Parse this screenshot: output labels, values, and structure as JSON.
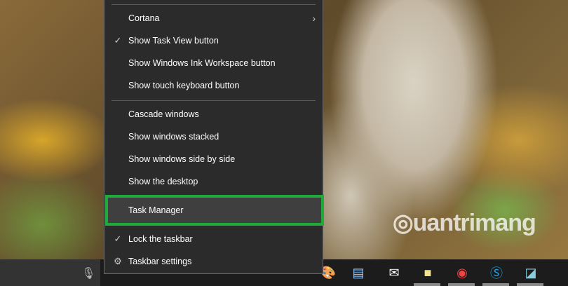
{
  "menu": {
    "items": [
      {
        "label": "Cortana",
        "icon": "",
        "submenu": true
      },
      {
        "label": "Show Task View button",
        "icon": "check-icon"
      },
      {
        "label": "Show Windows Ink Workspace button",
        "icon": ""
      },
      {
        "label": "Show touch keyboard button",
        "icon": ""
      },
      {
        "label": "Cascade windows",
        "icon": ""
      },
      {
        "label": "Show windows stacked",
        "icon": ""
      },
      {
        "label": "Show windows side by side",
        "icon": ""
      },
      {
        "label": "Show the desktop",
        "icon": ""
      },
      {
        "label": "Task Manager",
        "icon": "",
        "highlighted": true
      },
      {
        "label": "Lock the taskbar",
        "icon": "check-icon"
      },
      {
        "label": "Taskbar settings",
        "icon": "gear-icon"
      }
    ]
  },
  "highlight_color": "#1faa3c",
  "watermark": "uantrimang",
  "taskbar": {
    "icons": [
      "microphone-icon",
      "paint-icon",
      "wordpad-icon",
      "mail-icon",
      "sticky-notes-icon",
      "chrome-icon",
      "skype-icon",
      "notepad-icon"
    ]
  }
}
